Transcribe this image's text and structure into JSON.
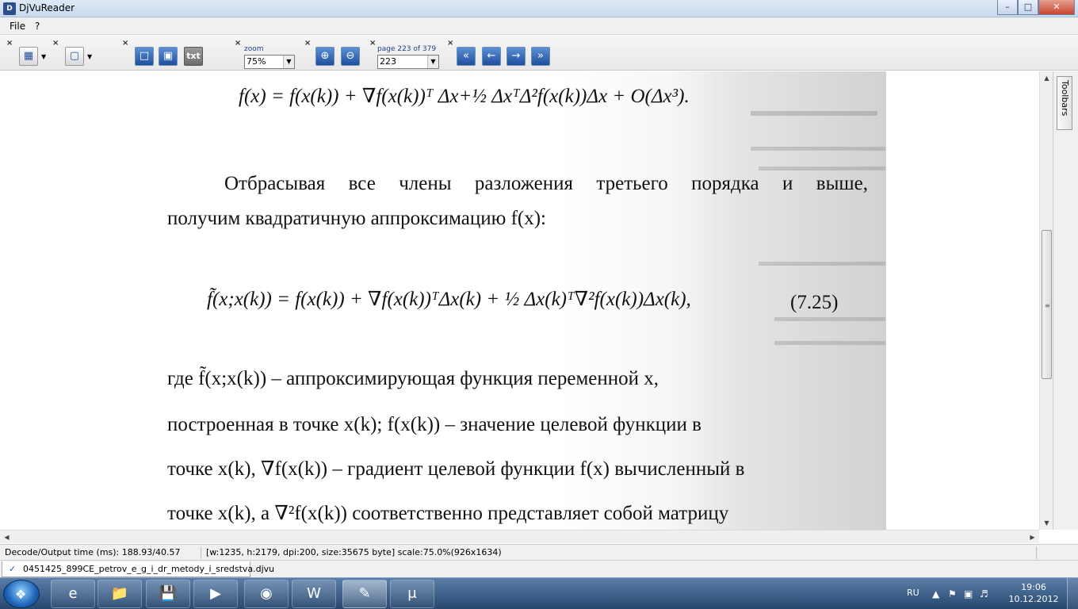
{
  "window": {
    "title": "DjVuReader"
  },
  "menu": {
    "file": "File",
    "help": "?"
  },
  "toolbar": {
    "close": "×",
    "zoom_label": "zoom",
    "zoom_value": "75%",
    "page_label": "page 223 of 379",
    "page_value": "223",
    "txt_label": "txt"
  },
  "document": {
    "formula1": "f(x) = f(x(k)) + ∇f(x(k))ᵀ Δx+½ ΔxᵀΔ²f(x(k))Δx + O(Δx³).",
    "line1": "Отбрасывая все члены разложения третьего порядка и выше,",
    "line2": "получим квадратичную аппроксимацию f(x):",
    "formula2": "f̃(x;x(k)) = f(x(k)) + ∇f(x(k))ᵀΔx(k) + ½ Δx(k)ᵀ∇²f(x(k))Δx(k),",
    "eqnum": "(7.25)",
    "line3": "где   f̃(x;x(k)) –   аппроксимирующая   функция   переменной   x,",
    "line4": "построенная в точке x(k);  f(x(k)) –  значение  целевой  функции  в",
    "line5": "точке x(k), ∇f(x(k)) – градиент целевой функции f(x) вычисленный в",
    "line6": "точке x(k),   а  ∇²f(x(k))  соответственно представляет собой матрицу"
  },
  "side": {
    "toolbars_label": "Toolbars"
  },
  "status": {
    "decode": "Decode/Output time (ms): 188.93/40.57",
    "info": "[w:1235, h:2179, dpi:200, size:35675 byte] scale:75.0%(926x1634)"
  },
  "file_tab": {
    "name": "0451425_899CE_petrov_e_g_i_dr_metody_i_sredstva.djvu"
  },
  "tray": {
    "lang": "RU",
    "time": "19:06",
    "date": "10.12.2012"
  }
}
